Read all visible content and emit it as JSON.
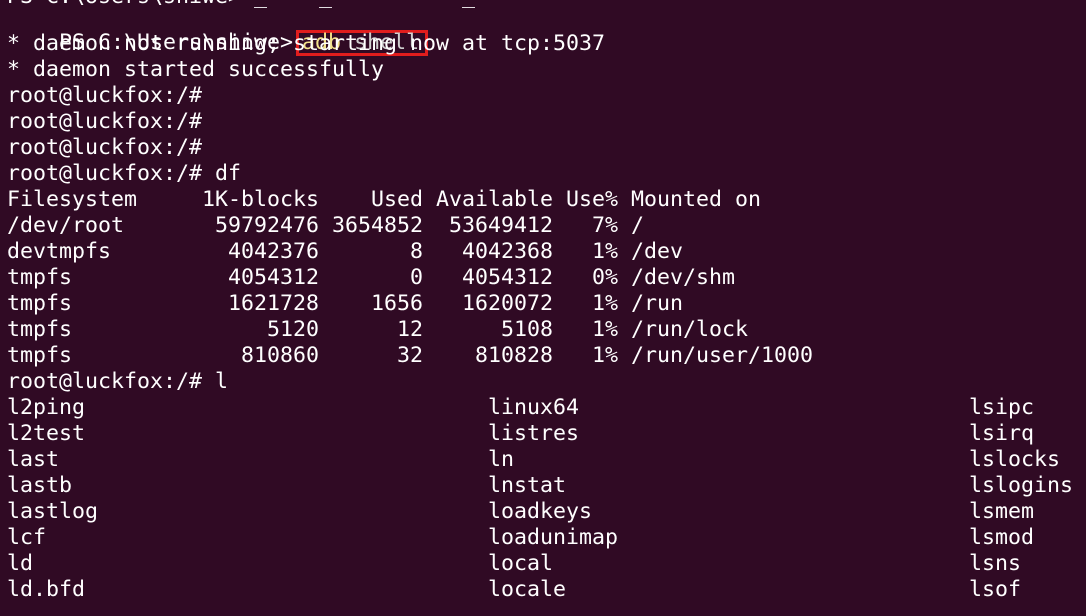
{
  "colors": {
    "background": "#300a24",
    "text": "#ffffff",
    "command_yellow": "#f2e28a",
    "command_gray": "#d0d0d0",
    "highlight_box": "#e11d1d"
  },
  "terminal": {
    "cut_top_line": "PS C:\\Users\\shiwe> _    _          _",
    "ps_prompt": "PS C:\\Users\\shiwe>",
    "command_program": "adb",
    "command_arg": "shell",
    "output_lines": [
      "* daemon not running; starting now at tcp:5037",
      "* daemon started successfully",
      "root@luckfox:/#",
      "root@luckfox:/#",
      "root@luckfox:/#",
      "root@luckfox:/# df"
    ],
    "df_table": {
      "headers": [
        "Filesystem",
        "1K-blocks",
        "Used",
        "Available",
        "Use%",
        "Mounted on"
      ],
      "rows": [
        [
          "/dev/root",
          "59792476",
          "3654852",
          "53649412",
          "7%",
          "/"
        ],
        [
          "devtmpfs",
          "4042376",
          "8",
          "4042368",
          "1%",
          "/dev"
        ],
        [
          "tmpfs",
          "4054312",
          "0",
          "4054312",
          "0%",
          "/dev/shm"
        ],
        [
          "tmpfs",
          "1621728",
          "1656",
          "1620072",
          "1%",
          "/run"
        ],
        [
          "tmpfs",
          "5120",
          "12",
          "5108",
          "1%",
          "/run/lock"
        ],
        [
          "tmpfs",
          "810860",
          "32",
          "810828",
          "1%",
          "/run/user/1000"
        ]
      ]
    },
    "ls_prompt": "root@luckfox:/# l",
    "completion_list": [
      [
        "l2ping",
        "linux64",
        "lsipc"
      ],
      [
        "l2test",
        "listres",
        "lsirq"
      ],
      [
        "last",
        "ln",
        "lslocks"
      ],
      [
        "lastb",
        "lnstat",
        "lslogins"
      ],
      [
        "lastlog",
        "loadkeys",
        "lsmem"
      ],
      [
        "lcf",
        "loadunimap",
        "lsmod"
      ],
      [
        "ld",
        "local",
        "lsns"
      ],
      [
        "ld.bfd",
        "locale",
        "lsof"
      ]
    ]
  }
}
